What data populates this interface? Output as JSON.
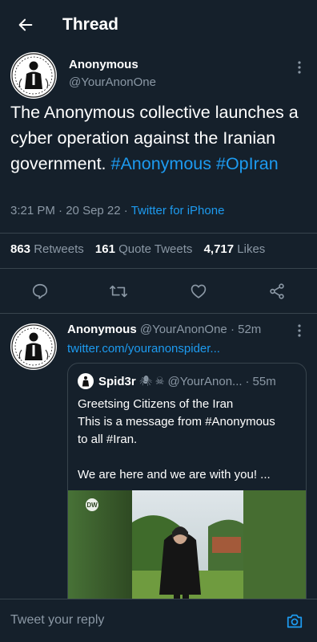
{
  "header": {
    "title": "Thread",
    "back_icon": "arrow-left-icon"
  },
  "main_tweet": {
    "author_name": "Anonymous",
    "author_handle": "@YourAnonOne",
    "text_plain": "The Anonymous collective launches a cyber operation against the Iranian government.",
    "hashtag_1": "#Anonymous",
    "hashtag_2": "#OpIran",
    "time": "3:21 PM",
    "date": "20 Sep 22",
    "source": "Twitter for iPhone",
    "meta_sep": "·",
    "stats": {
      "retweets_count": "863",
      "retweets_label": "Retweets",
      "quotes_count": "161",
      "quotes_label": "Quote Tweets",
      "likes_count": "4,717",
      "likes_label": "Likes"
    },
    "action_icons": [
      "reply-icon",
      "retweet-icon",
      "like-icon",
      "share-icon"
    ]
  },
  "reply_tweet": {
    "author_name": "Anonymous",
    "author_handle": "@YourAnonOne",
    "time_sep": "·",
    "time": "52m",
    "link": "twitter.com/youranonspider...",
    "quote": {
      "author_name": "Spid3r",
      "emojis": "🕷 ☠",
      "author_handle": "@YourAnon...",
      "time_sep": "·",
      "time": "55m",
      "line_1": "Greetsing Citizens of the Iran",
      "line_2": "This is a message from #Anonymous",
      "line_3": "to all #Iran.",
      "line_4": "We are here and we are with you! ...",
      "media_badge": "DW"
    }
  },
  "composer": {
    "placeholder": "Tweet your reply",
    "camera_icon": "camera-icon"
  },
  "colors": {
    "background": "#15202b",
    "accent": "#1d9bf0",
    "muted": "#8b98a5",
    "divider": "#38444d"
  }
}
